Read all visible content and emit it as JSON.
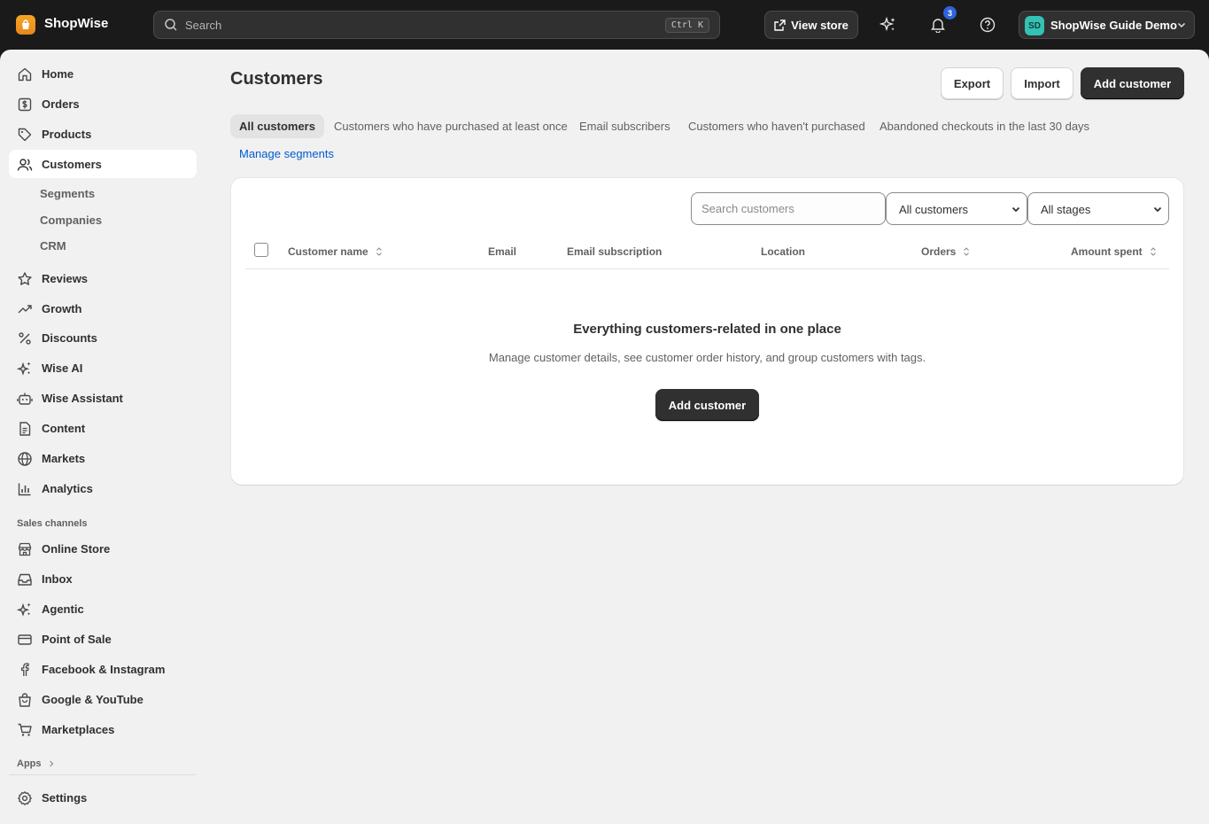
{
  "topbar": {
    "brand": "ShopWise",
    "search_placeholder": "Search",
    "search_shortcut": "Ctrl K",
    "view_store": "View store",
    "notification_count": "3",
    "account_initials": "SD",
    "account_name": "ShopWise Guide Demo"
  },
  "sidebar": {
    "items": [
      {
        "label": "Home",
        "icon": "home-icon"
      },
      {
        "label": "Orders",
        "icon": "orders-icon"
      },
      {
        "label": "Products",
        "icon": "tag-icon"
      },
      {
        "label": "Customers",
        "icon": "people-icon"
      },
      {
        "label": "Reviews",
        "icon": "star-icon"
      },
      {
        "label": "Growth",
        "icon": "trending-icon"
      },
      {
        "label": "Discounts",
        "icon": "percent-icon"
      },
      {
        "label": "Wise AI",
        "icon": "sparkle-icon"
      },
      {
        "label": "Wise Assistant",
        "icon": "robot-icon"
      },
      {
        "label": "Content",
        "icon": "document-icon"
      },
      {
        "label": "Markets",
        "icon": "globe-icon"
      },
      {
        "label": "Analytics",
        "icon": "bar-chart-icon"
      }
    ],
    "subitems": [
      "Segments",
      "Companies",
      "CRM"
    ],
    "sales_channels_label": "Sales channels",
    "channels": [
      {
        "label": "Online Store",
        "icon": "store-icon"
      },
      {
        "label": "Inbox",
        "icon": "inbox-icon"
      },
      {
        "label": "Agentic",
        "icon": "sparkle-icon"
      },
      {
        "label": "Point of Sale",
        "icon": "card-icon"
      },
      {
        "label": "Facebook & Instagram",
        "icon": "facebook-icon"
      },
      {
        "label": "Google & YouTube",
        "icon": "bag-icon"
      },
      {
        "label": "Marketplaces",
        "icon": "cart-icon"
      }
    ],
    "apps_label": "Apps",
    "settings_label": "Settings"
  },
  "page": {
    "title": "Customers",
    "export": "Export",
    "import": "Import",
    "add_customer": "Add customer",
    "tabs": [
      "All customers",
      "Customers who have purchased at least once",
      "Email subscribers",
      "Customers who haven't purchased",
      "Abandoned checkouts in the last 30 days"
    ],
    "manage_segments": "Manage segments"
  },
  "table": {
    "search_placeholder": "Search customers",
    "filter_customers": "All customers",
    "filter_stages": "All stages",
    "columns": [
      "Customer name",
      "Email",
      "Email subscription",
      "Location",
      "Orders",
      "Amount spent"
    ],
    "empty_title": "Everything customers-related in one place",
    "empty_desc": "Manage customer details, see customer order history, and group customers with tags.",
    "empty_cta": "Add customer"
  }
}
